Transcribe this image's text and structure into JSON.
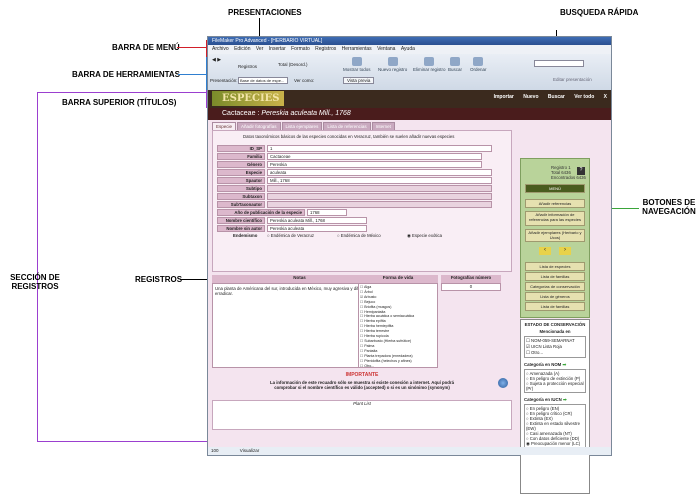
{
  "annotations": {
    "presentaciones": "PRESENTACIONES",
    "busqueda": "BUSQUEDA RÁPIDA",
    "barra_menu": "BARRA DE MENÚ",
    "barra_herramientas": "BARRA DE HERRAMIENTAS",
    "barra_superior": "BARRA SUPERIOR (TÍTULOS)",
    "botones_nav": "BOTONES DE NAVEGACIÓN",
    "seccion_registros": "SECCIÓN DE REGISTROS",
    "registros": "REGISTROS"
  },
  "window": {
    "title": "FileMaker Pro Advanced - [HERBARIO VIRTUAL]",
    "menu": [
      "Archivo",
      "Edición",
      "Ver",
      "Insertar",
      "Formato",
      "Registros",
      "Herramientas",
      "Ventana",
      "Ayuda"
    ]
  },
  "toolbar": {
    "records_label": "Registros",
    "total": "Total (Desord.)",
    "buttons": [
      "Mostrar todos",
      "Nuevo registro",
      "Eliminar registro",
      "Buscar",
      "Ordenar"
    ],
    "layout_label": "Presentación:",
    "layout_value": "Base de datos de espe...",
    "view_label": "Ver como:",
    "preview_btn": "Vista previa",
    "edit_layout": "Editar presentación"
  },
  "header": {
    "logo": "ESPECIES",
    "nav": [
      "Importar",
      "Nuevo",
      "Buscar",
      "Ver todo",
      "X"
    ]
  },
  "species": {
    "family": "Cactaceae",
    "name": "Pereskia aculeata Mill., 1768"
  },
  "tabs": [
    "Especie",
    "Añadir fotografías",
    "Lista ejemplares",
    "Lista de referencias",
    "Internet"
  ],
  "form": {
    "intro": "Datos taxonómicos básicos de las especies conocidas en Veracruz, también se suelen añadir nuevas especies",
    "fields": [
      {
        "label": "ID_SP",
        "value": "1"
      },
      {
        "label": "Familia",
        "value": "Cactaceae"
      },
      {
        "label": "Género",
        "value": "Pereskia"
      },
      {
        "label": "Especie",
        "value": "aculeata"
      },
      {
        "label": "Spautor",
        "value": "Mill., 1768"
      },
      {
        "label": "Subtipo",
        "value": ""
      },
      {
        "label": "Subtaxon",
        "value": ""
      },
      {
        "label": "SubTaxonautor",
        "value": ""
      },
      {
        "label": "Año de publicación de la especie",
        "value": "1768"
      },
      {
        "label": "Nombre científico",
        "value": "Pereskia aculeata Mill., 1768"
      },
      {
        "label": "Nombre sin autor",
        "value": "Pereskia aculeata"
      }
    ],
    "endemismo_label": "Endemismo",
    "endemismo_options": [
      "Endémica de Veracruz",
      "Endémica de México",
      "Especie exótica"
    ],
    "notas_label": "Notas",
    "notas_text": "Una planta de Américana del sur, introducida en México, muy agresiva y difícil de erradicar.",
    "forma_label": "Forma de vida",
    "forma_items": [
      "Alga",
      "Árbol",
      "Arbusto",
      "Bejuco",
      "Briofita (musgos)",
      "Hemiparásita",
      "Hierba acuática o semiacuática",
      "Hierba epífita",
      "Hierba hemiepífita",
      "Hierba terrestre",
      "Hierba rupícola",
      "Subarbusto (Hierba sufrútice)",
      "Palma",
      "Parásita",
      "Planta trepadora (enredadera)",
      "Pteridofita (helechos y afines)",
      "Otro..."
    ],
    "fotos_label": "Fotografías número",
    "fotos_value": "0",
    "importante": "IMPORTANTE",
    "importante_text": "La información de este recuadro sólo se muestra si existe conexión a internet. Aquí podrá comprobar si el nombre científico es válido (accepted) o si es un sinónimo (synonym)",
    "plant_list": "Plant List"
  },
  "nav": {
    "record_info": "Registro 1",
    "total": "Total 6436",
    "found": "Encontrados 6436",
    "menu": "MENÚ",
    "buttons": [
      "Añadir referencias",
      "Añadir información de referencias para las especies",
      "Añadir ejemplares (Herbario y Ucos)"
    ],
    "lists": [
      "Lista de especies",
      "Lista de familias",
      "Categorías de conservación",
      "Lista de géneros",
      "Lista de familias",
      "Lista de géneros"
    ]
  },
  "conservacion": {
    "title": "ESTADO DE CONSERVACIÓN",
    "mencionada": "Mencionada en",
    "sources": [
      "NOM-059-SEMARNAT",
      "UICN Lista Roja",
      "Otro..."
    ],
    "nom_label": "Categoría en NOM",
    "nom_options": [
      "Amenazada (A)",
      "En peligro de extinción (P)",
      "Sujeta a protección especial (Pr)"
    ],
    "uicn_label": "Categoría en IUCN",
    "uicn_options": [
      "En peligro (EN)",
      "En peligro crítico (CR)",
      "Extinta (EX)",
      "Extinta en estado silvestre (EW)",
      "Casi amenazada (NT)",
      "Con datos deficiente (DD)",
      "Preocupación menor (LC)",
      "Vulnerable (VU)"
    ]
  },
  "statusbar": {
    "zoom": "100",
    "mode": "Visualizar"
  },
  "colors": {
    "menu_box": "#d21f2a",
    "toolbar_box": "#2f7fd0",
    "header_box": "#9b3fcf",
    "nav_box": "#3aa53a"
  }
}
